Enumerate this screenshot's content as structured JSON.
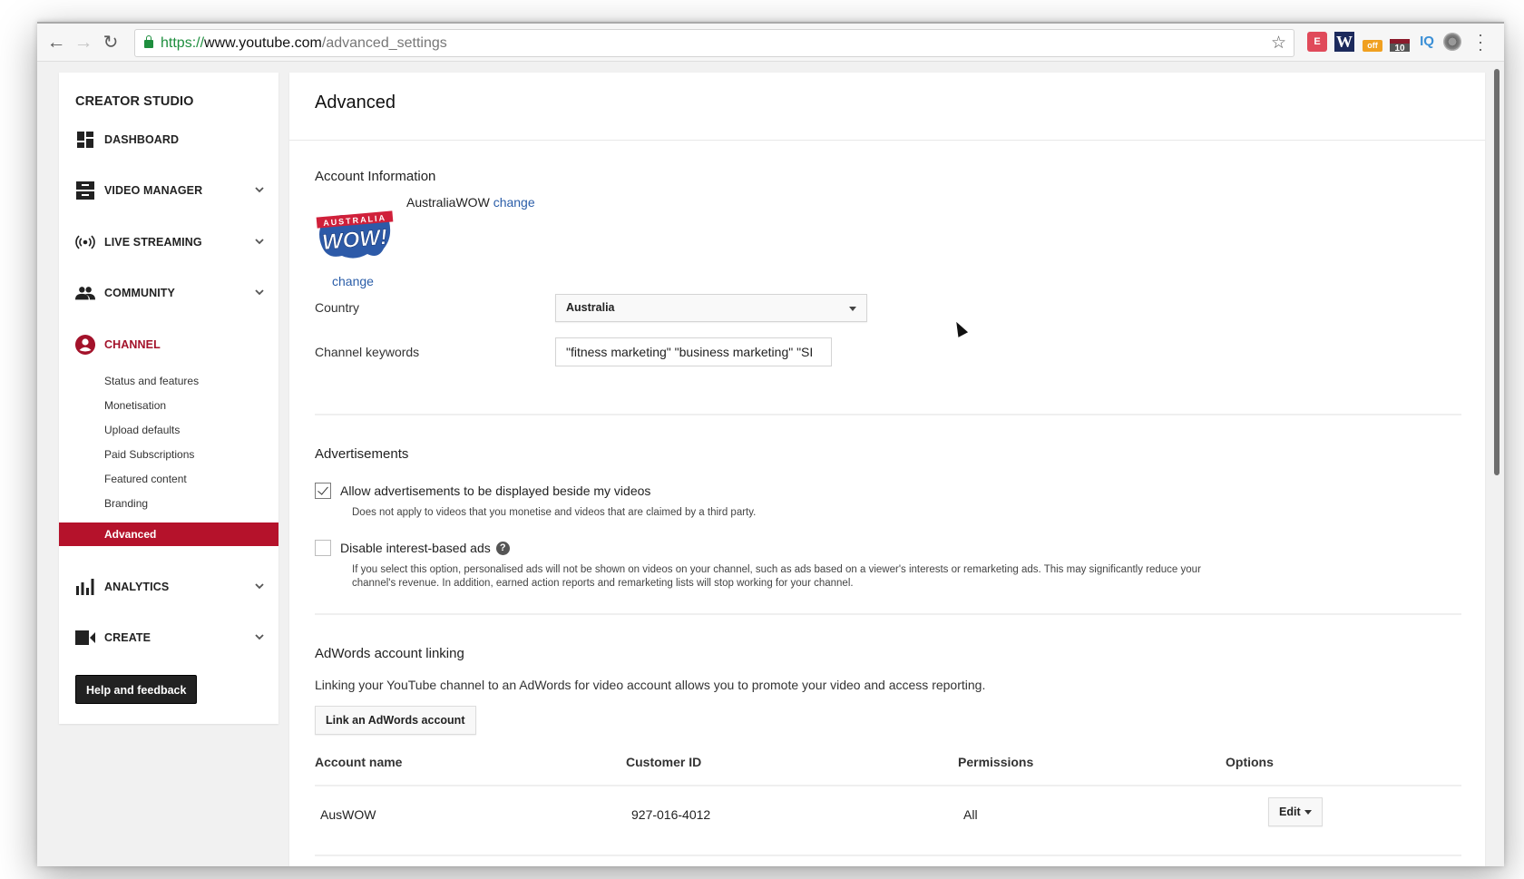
{
  "browser": {
    "url_scheme": "https://",
    "url_host": "www.youtube.com",
    "url_path": "/advanced_settings",
    "icons": {
      "back": "←",
      "forward": "→",
      "reload": "↻",
      "star": "☆",
      "menu": "⋮"
    },
    "extensions": [
      {
        "name": "tag-extension",
        "text": "E"
      },
      {
        "name": "w-extension",
        "text": "W"
      },
      {
        "name": "off-extension",
        "text": "off"
      },
      {
        "name": "calendar-extension",
        "text": "10"
      },
      {
        "name": "iq-extension",
        "text": "IQ"
      },
      {
        "name": "reel-extension",
        "text": ""
      }
    ]
  },
  "sidebar": {
    "title": "CREATOR STUDIO",
    "items": [
      {
        "label": "DASHBOARD",
        "icon": "dashboard-icon"
      },
      {
        "label": "VIDEO MANAGER",
        "icon": "video-manager-icon"
      },
      {
        "label": "LIVE STREAMING",
        "icon": "live-streaming-icon"
      },
      {
        "label": "COMMUNITY",
        "icon": "community-icon"
      },
      {
        "label": "CHANNEL",
        "icon": "channel-icon"
      },
      {
        "label": "ANALYTICS",
        "icon": "analytics-icon"
      },
      {
        "label": "CREATE",
        "icon": "create-icon"
      }
    ],
    "channel_subitems": [
      "Status and features",
      "Monetisation",
      "Upload defaults",
      "Paid Subscriptions",
      "Featured content",
      "Branding",
      "Advanced"
    ],
    "help_label": "Help and feedback",
    "accent_color": "#b5122b"
  },
  "main": {
    "title": "Advanced",
    "account_info": {
      "heading": "Account Information",
      "channel_name": "AustraliaWOW",
      "change_link": "change",
      "avatar_change_link": "change",
      "avatar_text_top": "AUSTRALIA",
      "avatar_text_main": "WOW!",
      "country_label": "Country",
      "country_value": "Australia",
      "keywords_label": "Channel keywords",
      "keywords_value": "\"fitness marketing\" \"business marketing\" \"SI"
    },
    "advertisements": {
      "heading": "Advertisements",
      "allow_ads_label": "Allow advertisements to be displayed beside my videos",
      "allow_ads_checked": true,
      "allow_ads_desc": "Does not apply to videos that you monetise and videos that are claimed by a third party.",
      "disable_interest_label": "Disable interest-based ads",
      "disable_interest_checked": false,
      "help_icon": "?",
      "disable_interest_desc_1": "If you select this option, personalised ads will not be shown on videos on your channel, such as ads based on a viewer's interests or remarketing ads. This may significantly reduce your",
      "disable_interest_desc_2": "channel's revenue. In addition, earned action reports and remarketing lists will stop working for your channel."
    },
    "adwords": {
      "heading": "AdWords account linking",
      "description": "Linking your YouTube channel to an AdWords for video account allows you to promote your video and access reporting.",
      "link_button": "Link an AdWords account",
      "columns": [
        "Account name",
        "Customer ID",
        "Permissions",
        "Options"
      ],
      "rows": [
        {
          "account_name": "AusWOW",
          "customer_id": "927-016-4012",
          "permissions": "All",
          "option": "Edit"
        }
      ]
    }
  }
}
